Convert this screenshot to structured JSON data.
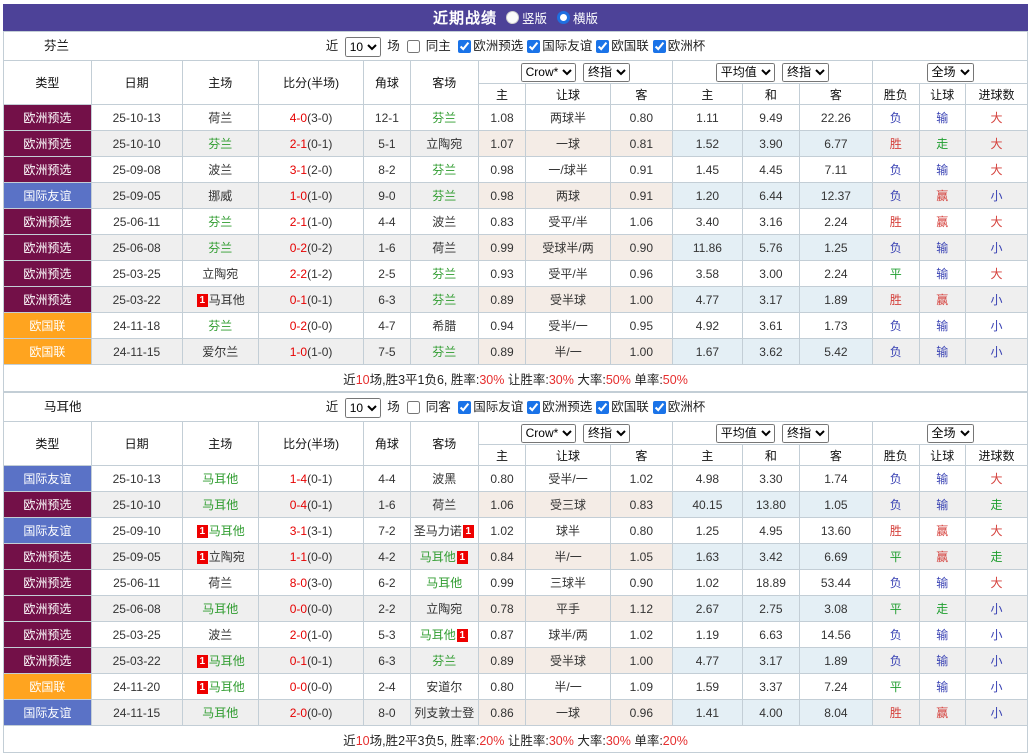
{
  "title_bar": {
    "title": "近期战绩",
    "layout_options": [
      {
        "label": "竖版",
        "selected": false
      },
      {
        "label": "横版",
        "selected": true
      }
    ]
  },
  "table_header": {
    "static_cols": [
      "类型",
      "日期",
      "主场",
      "比分(半场)",
      "角球",
      "客场"
    ],
    "handicap_group": {
      "dropdown1": "Crow*",
      "dropdown2": "终指",
      "cols": [
        "主",
        "让球",
        "客"
      ]
    },
    "average_group": {
      "dropdown1": "平均值",
      "dropdown2": "终指",
      "cols": [
        "主",
        "和",
        "客"
      ]
    },
    "fulltime_group": {
      "dropdown": "全场",
      "cols": [
        "胜负",
        "让球",
        "进球数"
      ]
    }
  },
  "type_colors": {
    "欧洲预选": "#731048",
    "国际友谊": "#5a72c6",
    "欧国联": "#ffa41f"
  },
  "result_colors": {
    "胜": "red",
    "平": "green",
    "负": "blue",
    "赢": "red",
    "走": "green",
    "输": "blue",
    "大": "red",
    "小": "blue"
  },
  "accent_colors": {
    "titlebar_purple": "#4d4298",
    "team_green": "#2f9c2f",
    "score_red": "#e60000",
    "badge_red": "#ee0000",
    "result_red": "#d5413c",
    "result_green": "#1f9e2f",
    "result_blue": "#3a43b4"
  },
  "sections": [
    {
      "team": "芬兰",
      "controls": {
        "near_label": "近",
        "count": "10",
        "games_label": "场",
        "same_checkbox": {
          "label": "同主",
          "checked": false
        },
        "league_checkboxes": [
          {
            "label": "欧洲预选",
            "checked": true
          },
          {
            "label": "国际友谊",
            "checked": true
          },
          {
            "label": "欧国联",
            "checked": true
          },
          {
            "label": "欧洲杯",
            "checked": true
          }
        ]
      },
      "rows": [
        {
          "type": "欧洲预选",
          "date": "25-10-13",
          "home": "荷兰",
          "home_green": false,
          "home_badge": "",
          "score": "4-0",
          "half": "(3-0)",
          "corners": "12-1",
          "away": "芬兰",
          "away_green": true,
          "away_badge": "",
          "h_home": "1.08",
          "handicap": "两球半",
          "h_away": "0.80",
          "avg_home": "1.11",
          "avg_draw": "9.49",
          "avg_away": "22.26",
          "res_win": "负",
          "res_handicap": "输",
          "res_goals": "大"
        },
        {
          "type": "欧洲预选",
          "date": "25-10-10",
          "home": "芬兰",
          "home_green": true,
          "home_badge": "",
          "score": "2-1",
          "half": "(0-1)",
          "corners": "5-1",
          "away": "立陶宛",
          "away_green": false,
          "away_badge": "",
          "h_home": "1.07",
          "handicap": "一球",
          "h_away": "0.81",
          "avg_home": "1.52",
          "avg_draw": "3.90",
          "avg_away": "6.77",
          "res_win": "胜",
          "res_handicap": "走",
          "res_goals": "大"
        },
        {
          "type": "欧洲预选",
          "date": "25-09-08",
          "home": "波兰",
          "home_green": false,
          "home_badge": "",
          "score": "3-1",
          "half": "(2-0)",
          "corners": "8-2",
          "away": "芬兰",
          "away_green": true,
          "away_badge": "",
          "h_home": "0.98",
          "handicap": "一/球半",
          "h_away": "0.91",
          "avg_home": "1.45",
          "avg_draw": "4.45",
          "avg_away": "7.11",
          "res_win": "负",
          "res_handicap": "输",
          "res_goals": "大"
        },
        {
          "type": "国际友谊",
          "date": "25-09-05",
          "home": "挪威",
          "home_green": false,
          "home_badge": "",
          "score": "1-0",
          "half": "(1-0)",
          "corners": "9-0",
          "away": "芬兰",
          "away_green": true,
          "away_badge": "",
          "h_home": "0.98",
          "handicap": "两球",
          "h_away": "0.91",
          "avg_home": "1.20",
          "avg_draw": "6.44",
          "avg_away": "12.37",
          "res_win": "负",
          "res_handicap": "赢",
          "res_goals": "小"
        },
        {
          "type": "欧洲预选",
          "date": "25-06-11",
          "home": "芬兰",
          "home_green": true,
          "home_badge": "",
          "score": "2-1",
          "half": "(1-0)",
          "corners": "4-4",
          "away": "波兰",
          "away_green": false,
          "away_badge": "",
          "h_home": "0.83",
          "handicap": "受平/半",
          "h_away": "1.06",
          "avg_home": "3.40",
          "avg_draw": "3.16",
          "avg_away": "2.24",
          "res_win": "胜",
          "res_handicap": "赢",
          "res_goals": "大"
        },
        {
          "type": "欧洲预选",
          "date": "25-06-08",
          "home": "芬兰",
          "home_green": true,
          "home_badge": "",
          "score": "0-2",
          "half": "(0-2)",
          "corners": "1-6",
          "away": "荷兰",
          "away_green": false,
          "away_badge": "",
          "h_home": "0.99",
          "handicap": "受球半/两",
          "h_away": "0.90",
          "avg_home": "11.86",
          "avg_draw": "5.76",
          "avg_away": "1.25",
          "res_win": "负",
          "res_handicap": "输",
          "res_goals": "小"
        },
        {
          "type": "欧洲预选",
          "date": "25-03-25",
          "home": "立陶宛",
          "home_green": false,
          "home_badge": "",
          "score": "2-2",
          "half": "(1-2)",
          "corners": "2-5",
          "away": "芬兰",
          "away_green": true,
          "away_badge": "",
          "h_home": "0.93",
          "handicap": "受平/半",
          "h_away": "0.96",
          "avg_home": "3.58",
          "avg_draw": "3.00",
          "avg_away": "2.24",
          "res_win": "平",
          "res_handicap": "输",
          "res_goals": "大"
        },
        {
          "type": "欧洲预选",
          "date": "25-03-22",
          "home": "马耳他",
          "home_green": false,
          "home_badge": "1",
          "score": "0-1",
          "half": "(0-1)",
          "corners": "6-3",
          "away": "芬兰",
          "away_green": true,
          "away_badge": "",
          "h_home": "0.89",
          "handicap": "受半球",
          "h_away": "1.00",
          "avg_home": "4.77",
          "avg_draw": "3.17",
          "avg_away": "1.89",
          "res_win": "胜",
          "res_handicap": "赢",
          "res_goals": "小"
        },
        {
          "type": "欧国联",
          "date": "24-11-18",
          "home": "芬兰",
          "home_green": true,
          "home_badge": "",
          "score": "0-2",
          "half": "(0-0)",
          "corners": "4-7",
          "away": "希腊",
          "away_green": false,
          "away_badge": "",
          "h_home": "0.94",
          "handicap": "受半/一",
          "h_away": "0.95",
          "avg_home": "4.92",
          "avg_draw": "3.61",
          "avg_away": "1.73",
          "res_win": "负",
          "res_handicap": "输",
          "res_goals": "小"
        },
        {
          "type": "欧国联",
          "date": "24-11-15",
          "home": "爱尔兰",
          "home_green": false,
          "home_badge": "",
          "score": "1-0",
          "half": "(1-0)",
          "corners": "7-5",
          "away": "芬兰",
          "away_green": true,
          "away_badge": "",
          "h_home": "0.89",
          "handicap": "半/一",
          "h_away": "1.00",
          "avg_home": "1.67",
          "avg_draw": "3.62",
          "avg_away": "5.42",
          "res_win": "负",
          "res_handicap": "输",
          "res_goals": "小"
        }
      ],
      "summary": [
        {
          "t": "近",
          "c": "k"
        },
        {
          "t": "10",
          "c": "r"
        },
        {
          "t": "场,胜3平1负6, 胜率:",
          "c": "k"
        },
        {
          "t": "30%",
          "c": "r"
        },
        {
          "t": " 让胜率:",
          "c": "k"
        },
        {
          "t": "30%",
          "c": "r"
        },
        {
          "t": " 大率:",
          "c": "k"
        },
        {
          "t": "50%",
          "c": "r"
        },
        {
          "t": " 单率:",
          "c": "k"
        },
        {
          "t": "50%",
          "c": "r"
        }
      ]
    },
    {
      "team": "马耳他",
      "controls": {
        "near_label": "近",
        "count": "10",
        "games_label": "场",
        "same_checkbox": {
          "label": "同客",
          "checked": false
        },
        "league_checkboxes": [
          {
            "label": "国际友谊",
            "checked": true
          },
          {
            "label": "欧洲预选",
            "checked": true
          },
          {
            "label": "欧国联",
            "checked": true
          },
          {
            "label": "欧洲杯",
            "checked": true
          }
        ]
      },
      "rows": [
        {
          "type": "国际友谊",
          "date": "25-10-13",
          "home": "马耳他",
          "home_green": true,
          "home_badge": "",
          "score": "1-4",
          "half": "(0-1)",
          "corners": "4-4",
          "away": "波黑",
          "away_green": false,
          "away_badge": "",
          "h_home": "0.80",
          "handicap": "受半/一",
          "h_away": "1.02",
          "avg_home": "4.98",
          "avg_draw": "3.30",
          "avg_away": "1.74",
          "res_win": "负",
          "res_handicap": "输",
          "res_goals": "大"
        },
        {
          "type": "欧洲预选",
          "date": "25-10-10",
          "home": "马耳他",
          "home_green": true,
          "home_badge": "",
          "score": "0-4",
          "half": "(0-1)",
          "corners": "1-6",
          "away": "荷兰",
          "away_green": false,
          "away_badge": "",
          "h_home": "1.06",
          "handicap": "受三球",
          "h_away": "0.83",
          "avg_home": "40.15",
          "avg_draw": "13.80",
          "avg_away": "1.05",
          "res_win": "负",
          "res_handicap": "输",
          "res_goals": "走"
        },
        {
          "type": "国际友谊",
          "date": "25-09-10",
          "home": "马耳他",
          "home_green": true,
          "home_badge": "1",
          "score": "3-1",
          "half": "(3-1)",
          "corners": "7-2",
          "away": "圣马力诺",
          "away_green": false,
          "away_badge": "1",
          "h_home": "1.02",
          "handicap": "球半",
          "h_away": "0.80",
          "avg_home": "1.25",
          "avg_draw": "4.95",
          "avg_away": "13.60",
          "res_win": "胜",
          "res_handicap": "赢",
          "res_goals": "大"
        },
        {
          "type": "欧洲预选",
          "date": "25-09-05",
          "home": "立陶宛",
          "home_green": false,
          "home_badge": "1",
          "score": "1-1",
          "half": "(0-0)",
          "corners": "4-2",
          "away": "马耳他",
          "away_green": true,
          "away_badge": "1",
          "h_home": "0.84",
          "handicap": "半/一",
          "h_away": "1.05",
          "avg_home": "1.63",
          "avg_draw": "3.42",
          "avg_away": "6.69",
          "res_win": "平",
          "res_handicap": "赢",
          "res_goals": "走"
        },
        {
          "type": "欧洲预选",
          "date": "25-06-11",
          "home": "荷兰",
          "home_green": false,
          "home_badge": "",
          "score": "8-0",
          "half": "(3-0)",
          "corners": "6-2",
          "away": "马耳他",
          "away_green": true,
          "away_badge": "",
          "h_home": "0.99",
          "handicap": "三球半",
          "h_away": "0.90",
          "avg_home": "1.02",
          "avg_draw": "18.89",
          "avg_away": "53.44",
          "res_win": "负",
          "res_handicap": "输",
          "res_goals": "大"
        },
        {
          "type": "欧洲预选",
          "date": "25-06-08",
          "home": "马耳他",
          "home_green": true,
          "home_badge": "",
          "score": "0-0",
          "half": "(0-0)",
          "corners": "2-2",
          "away": "立陶宛",
          "away_green": false,
          "away_badge": "",
          "h_home": "0.78",
          "handicap": "平手",
          "h_away": "1.12",
          "avg_home": "2.67",
          "avg_draw": "2.75",
          "avg_away": "3.08",
          "res_win": "平",
          "res_handicap": "走",
          "res_goals": "小"
        },
        {
          "type": "欧洲预选",
          "date": "25-03-25",
          "home": "波兰",
          "home_green": false,
          "home_badge": "",
          "score": "2-0",
          "half": "(1-0)",
          "corners": "5-3",
          "away": "马耳他",
          "away_green": true,
          "away_badge": "1",
          "h_home": "0.87",
          "handicap": "球半/两",
          "h_away": "1.02",
          "avg_home": "1.19",
          "avg_draw": "6.63",
          "avg_away": "14.56",
          "res_win": "负",
          "res_handicap": "输",
          "res_goals": "小"
        },
        {
          "type": "欧洲预选",
          "date": "25-03-22",
          "home": "马耳他",
          "home_green": true,
          "home_badge": "1",
          "score": "0-1",
          "half": "(0-1)",
          "corners": "6-3",
          "away": "芬兰",
          "away_green": true,
          "away_badge": "",
          "h_home": "0.89",
          "handicap": "受半球",
          "h_away": "1.00",
          "avg_home": "4.77",
          "avg_draw": "3.17",
          "avg_away": "1.89",
          "res_win": "负",
          "res_handicap": "输",
          "res_goals": "小"
        },
        {
          "type": "欧国联",
          "date": "24-11-20",
          "home": "马耳他",
          "home_green": true,
          "home_badge": "1",
          "score": "0-0",
          "half": "(0-0)",
          "corners": "2-4",
          "away": "安道尔",
          "away_green": false,
          "away_badge": "",
          "h_home": "0.80",
          "handicap": "半/一",
          "h_away": "1.09",
          "avg_home": "1.59",
          "avg_draw": "3.37",
          "avg_away": "7.24",
          "res_win": "平",
          "res_handicap": "输",
          "res_goals": "小"
        },
        {
          "type": "国际友谊",
          "date": "24-11-15",
          "home": "马耳他",
          "home_green": true,
          "home_badge": "",
          "score": "2-0",
          "half": "(0-0)",
          "corners": "8-0",
          "away": "列支敦士登",
          "away_green": false,
          "away_badge": "",
          "h_home": "0.86",
          "handicap": "一球",
          "h_away": "0.96",
          "avg_home": "1.41",
          "avg_draw": "4.00",
          "avg_away": "8.04",
          "res_win": "胜",
          "res_handicap": "赢",
          "res_goals": "小"
        }
      ],
      "summary": [
        {
          "t": "近",
          "c": "k"
        },
        {
          "t": "10",
          "c": "r"
        },
        {
          "t": "场,胜2平3负5, 胜率:",
          "c": "k"
        },
        {
          "t": "20%",
          "c": "r"
        },
        {
          "t": " 让胜率:",
          "c": "k"
        },
        {
          "t": "30%",
          "c": "r"
        },
        {
          "t": " 大率:",
          "c": "k"
        },
        {
          "t": "30%",
          "c": "r"
        },
        {
          "t": " 单率:",
          "c": "k"
        },
        {
          "t": "20%",
          "c": "r"
        }
      ]
    }
  ]
}
